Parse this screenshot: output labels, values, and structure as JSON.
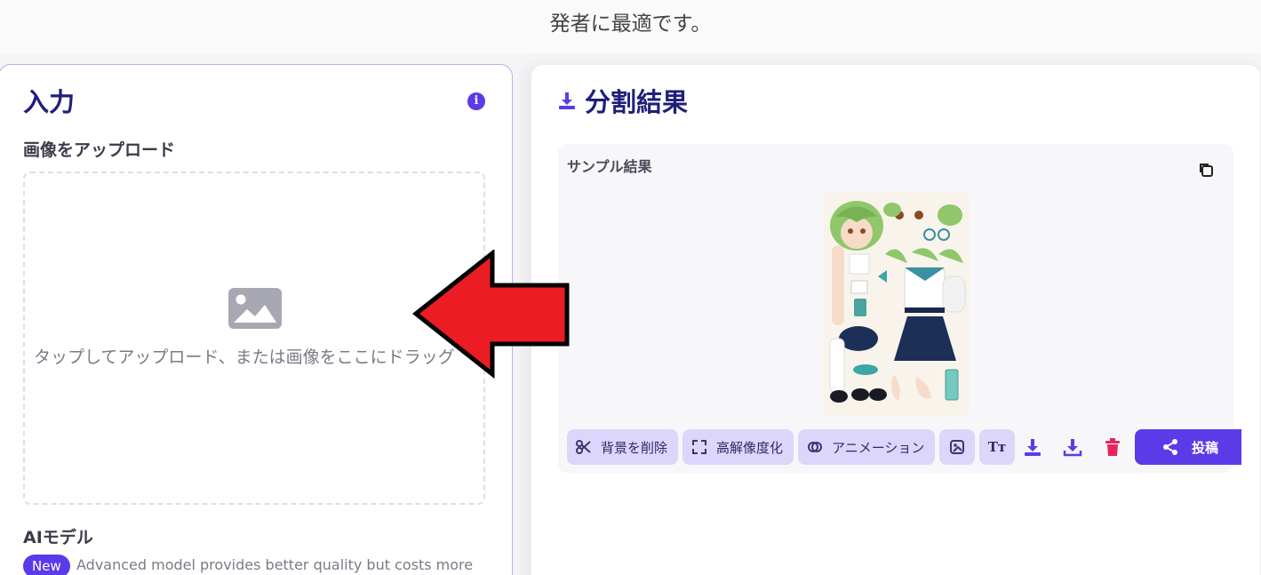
{
  "header": {
    "text": "発者に最適です。"
  },
  "input_panel": {
    "title": "入力",
    "upload_label": "画像をアップロード",
    "dropzone_text": "タップしてアップロード、または画像をここにドラッグ",
    "model_label": "AIモデル",
    "new_badge": "New",
    "model_desc": "Advanced model provides better quality but costs more"
  },
  "result_panel": {
    "title": "分割結果",
    "sample_label": "サンプル結果",
    "toolbar": {
      "remove_bg": "背景を削除",
      "upscale": "高解像度化",
      "animation": "アニメーション",
      "post": "投稿"
    }
  },
  "colors": {
    "accent": "#5b3be8",
    "title": "#1f1f7a",
    "button_bg": "#dcd6fb",
    "delete": "#e8245f",
    "arrow": "#ec1c24"
  },
  "icons": [
    "info-icon",
    "image-icon",
    "download-icon",
    "copy-icon",
    "scissors-icon",
    "expand-icon",
    "link-icon",
    "image-edit-icon",
    "text-icon",
    "trash-icon",
    "share-icon"
  ]
}
